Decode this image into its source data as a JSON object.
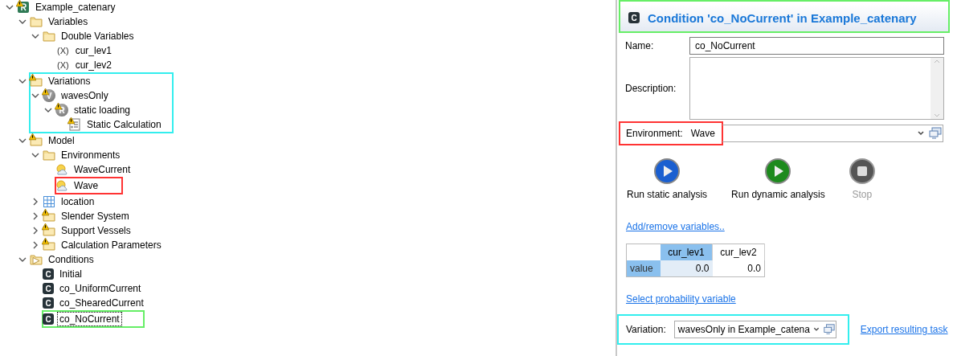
{
  "tree": [
    {
      "label": "Example_catenary",
      "kind": "project",
      "warning": true,
      "expanded": true,
      "selected": false,
      "children": [
        {
          "label": "Variables",
          "kind": "folder",
          "warning": false,
          "expanded": true,
          "selected": false,
          "children": [
            {
              "label": "Double Variables",
              "kind": "folder",
              "warning": false,
              "expanded": true,
              "selected": false,
              "children": [
                {
                  "label": "cur_lev1",
                  "kind": "variable",
                  "prefix": "(X)",
                  "warning": false,
                  "selected": false
                },
                {
                  "label": "cur_lev2",
                  "kind": "variable",
                  "prefix": "(X)",
                  "warning": false,
                  "selected": false
                }
              ]
            }
          ]
        },
        {
          "label": "Variations",
          "kind": "folder",
          "warning": true,
          "expanded": true,
          "selected": false,
          "color": "#33eeee",
          "children": [
            {
              "label": "wavesOnly",
              "kind": "circle",
              "badge": "V",
              "warning": true,
              "expanded": true,
              "selected": false,
              "children": [
                {
                  "label": "static loading",
                  "kind": "circle",
                  "badge": "R",
                  "warning": true,
                  "expanded": true,
                  "selected": false,
                  "children": [
                    {
                      "label": "Static Calculation",
                      "kind": "calc",
                      "warning": true,
                      "selected": false
                    }
                  ]
                }
              ]
            }
          ]
        },
        {
          "label": "Model",
          "kind": "folder",
          "warning": true,
          "expanded": true,
          "selected": false,
          "children": [
            {
              "label": "Environments",
              "kind": "folder",
              "warning": false,
              "expanded": true,
              "selected": false,
              "children": [
                {
                  "label": "WaveCurrent",
                  "kind": "weather",
                  "warning": false,
                  "selected": false
                },
                {
                  "label": "Wave",
                  "kind": "weather",
                  "warning": false,
                  "selected": false,
                  "color": "#ff3333"
                }
              ]
            },
            {
              "label": "location",
              "kind": "grid",
              "warning": false,
              "expanded": false,
              "selected": false
            },
            {
              "label": "Slender System",
              "kind": "folder",
              "warning": true,
              "expanded": false,
              "selected": false
            },
            {
              "label": "Support Vessels",
              "kind": "folder",
              "warning": true,
              "expanded": false,
              "selected": false
            },
            {
              "label": "Calculation Parameters",
              "kind": "folder",
              "warning": true,
              "expanded": false,
              "selected": false
            }
          ]
        },
        {
          "label": "Conditions",
          "kind": "folder-arrow",
          "warning": false,
          "expanded": true,
          "selected": false,
          "children": [
            {
              "label": "Initial",
              "kind": "condition",
              "badge": "C",
              "warning": false,
              "selected": false
            },
            {
              "label": "co_UniformCurrent",
              "kind": "condition",
              "badge": "C",
              "warning": false,
              "selected": false
            },
            {
              "label": "co_ShearedCurrent",
              "kind": "condition",
              "badge": "C",
              "warning": false,
              "selected": false
            },
            {
              "label": "co_NoCurrent",
              "kind": "condition",
              "badge": "C",
              "warning": false,
              "selected": true,
              "color": "#66ee66"
            }
          ]
        }
      ]
    }
  ],
  "editor": {
    "title": {
      "badge": "C",
      "text": "Condition 'co_NoCurrent' in Example_catenary",
      "color": "#66ee66"
    },
    "name": {
      "label": "Name:",
      "value": "co_NoCurrent"
    },
    "description": {
      "label": "Description:"
    },
    "environment": {
      "label": "Environment:",
      "value": "Wave",
      "color": "#ff3333"
    },
    "actions": [
      {
        "kind": "static",
        "label": "Run static analysis",
        "disabled": false
      },
      {
        "kind": "dynamic",
        "label": "Run dynamic analysis",
        "disabled": false
      },
      {
        "kind": "stop",
        "label": "Stop",
        "disabled": true
      }
    ],
    "variables_link": "Add/remove variables..",
    "table": {
      "columns": [
        {
          "label": "cur_lev1",
          "selected": true
        },
        {
          "label": "cur_lev2",
          "selected": false
        }
      ],
      "rows": [
        {
          "label": "value",
          "selected": true,
          "values": [
            "0.0",
            "0.0"
          ]
        }
      ]
    },
    "probability_link": "Select probability variable",
    "variation": {
      "label": "Variation:",
      "value": "wavesOnly in Example_catena",
      "color": "#33eeee"
    },
    "export_link": "Export resulting task"
  }
}
